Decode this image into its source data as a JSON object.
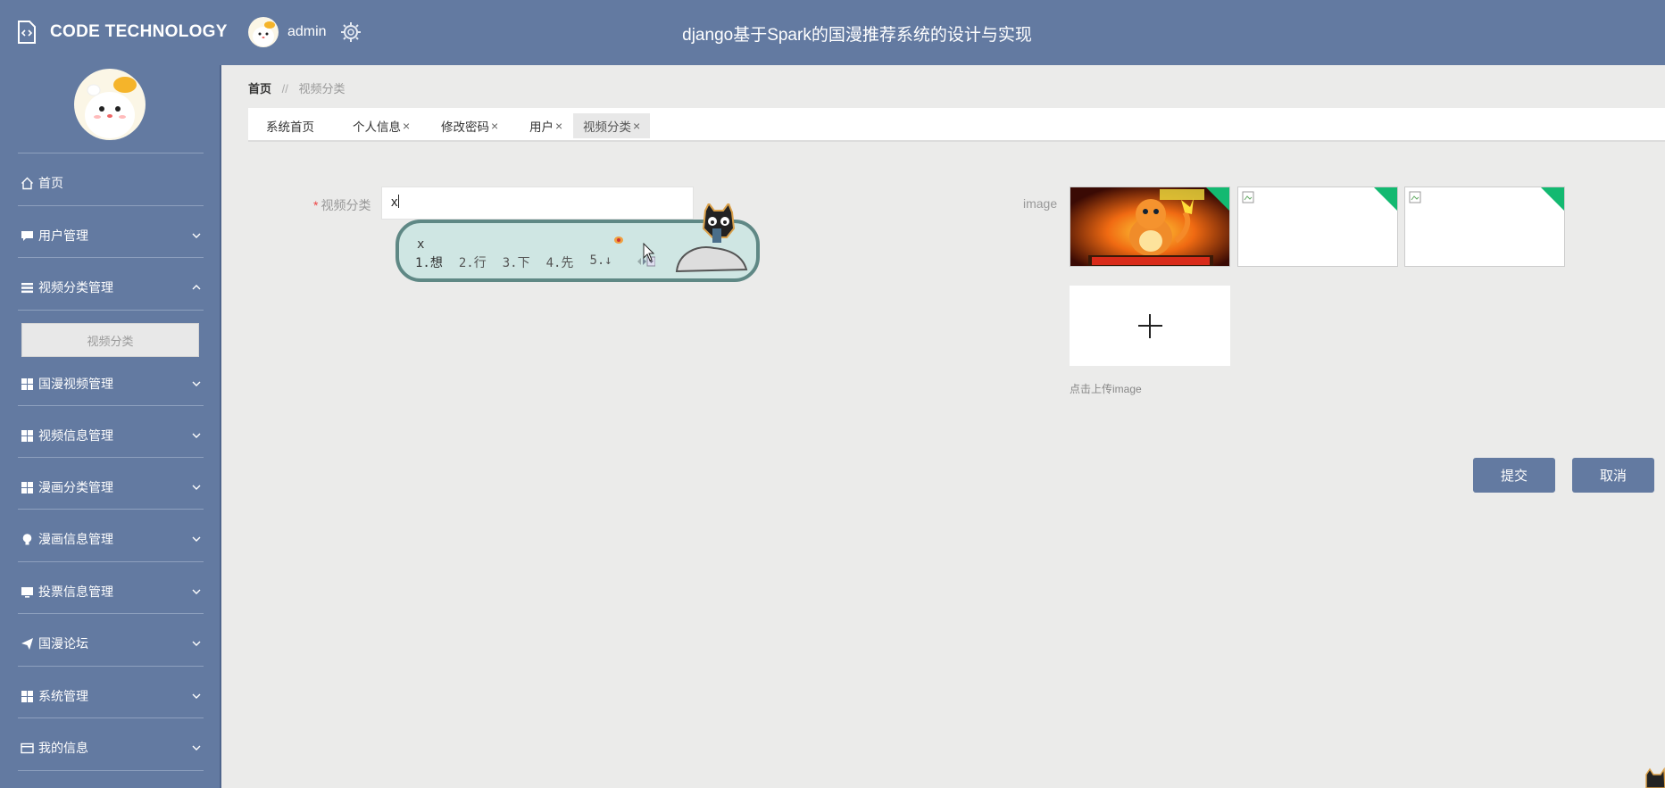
{
  "header": {
    "logo_text": "CODE TECHNOLOGY",
    "username": "admin",
    "title": "django基于Spark的国漫推荐系统的设计与实现"
  },
  "sidebar": {
    "items": [
      {
        "label": "首页",
        "icon": "home-icon"
      },
      {
        "label": "用户管理",
        "icon": "chat-icon"
      },
      {
        "label": "视频分类管理",
        "icon": "list-icon",
        "expanded": true
      },
      {
        "label": "国漫视频管理",
        "icon": "grid-icon"
      },
      {
        "label": "视频信息管理",
        "icon": "grid-icon"
      },
      {
        "label": "漫画分类管理",
        "icon": "grid-icon"
      },
      {
        "label": "漫画信息管理",
        "icon": "bulb-icon"
      },
      {
        "label": "投票信息管理",
        "icon": "monitor-icon"
      },
      {
        "label": "国漫论坛",
        "icon": "send-icon"
      },
      {
        "label": "系统管理",
        "icon": "grid-icon"
      },
      {
        "label": "我的信息",
        "icon": "card-icon"
      }
    ],
    "submenu_label": "视频分类"
  },
  "breadcrumb": {
    "home": "首页",
    "separator": "//",
    "current": "视频分类"
  },
  "tabs": [
    {
      "label": "系统首页",
      "closable": false
    },
    {
      "label": "个人信息",
      "closable": true
    },
    {
      "label": "修改密码",
      "closable": true
    },
    {
      "label": "用户",
      "closable": true
    },
    {
      "label": "视频分类",
      "closable": true,
      "active": true
    }
  ],
  "tab_close_glyph": "×",
  "form": {
    "required_mark": "*",
    "category_label": "视频分类",
    "category_value": "x",
    "image_label": "image",
    "upload_hint": "点击上传image",
    "submit_label": "提交",
    "cancel_label": "取消"
  },
  "ime": {
    "composition": "x",
    "candidates": [
      "1.想",
      "2.行",
      "3.下",
      "4.先",
      "5.↓"
    ]
  },
  "colors": {
    "primary": "#637aa1",
    "uploaded_corner": "#13b971",
    "background": "#ebebea"
  }
}
